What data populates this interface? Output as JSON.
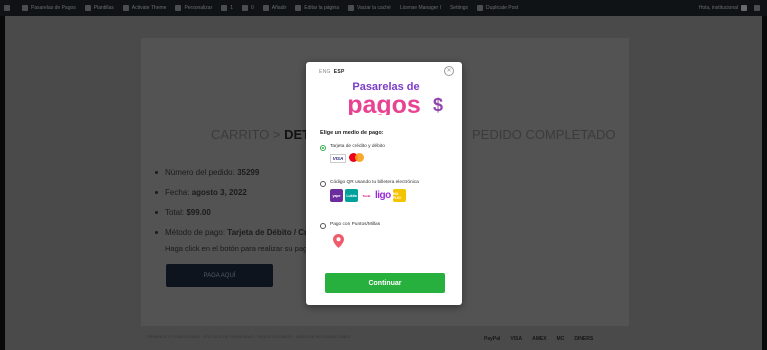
{
  "admin_bar": {
    "items": [
      "Pasarelas de Pagos",
      "Plantillas",
      "Activate Theme",
      "Personalizar",
      "1",
      "0",
      "Añadir",
      "Editar la página",
      "Vaciar la caché",
      "License Manager I",
      "Settings",
      "Duplicate Post"
    ],
    "greeting": "Hola, institucional"
  },
  "checkout": {
    "step1": "CARRITO",
    "sep": ">",
    "step2": "DETALLES DEL PAGO",
    "step3": "PEDIDO COMPLETADO",
    "order_number_label": "Número del pedido:",
    "order_number": "35299",
    "date_label": "Fecha:",
    "date": "agosto 3, 2022",
    "total_label": "Total:",
    "total": "$99.00",
    "method_label": "Método de pago:",
    "method": "Tarjeta de Débito / Crédito",
    "hint": "Haga click en el botón para realizar su pago",
    "pay_button": "PAGA AQUÍ"
  },
  "footer": {
    "links": "TÉRMINOS Y CONDICIONES · POLÍTICA DE PRIVACIDAD · PAGOS SEGUROS · LIBRO DE RECLAMACIONES",
    "payments": [
      "PayPal",
      "VISA",
      "AMEX",
      "MC",
      "DINERS"
    ]
  },
  "modal": {
    "lang_eng": "ENG",
    "lang_esp": "ESP",
    "close_symbol": "✕",
    "logo_line1": "Pasarelas de",
    "logo_line2": "pagos",
    "choose_label": "Elige un medio de pago:",
    "options": [
      {
        "label": "Tarjeta de crédito y débito",
        "selected": true
      },
      {
        "label": "Código QR usando tu billetera electrónica",
        "selected": false
      },
      {
        "label": "Pago con Puntos/Millas",
        "selected": false
      }
    ],
    "card_brands": [
      "VISA",
      "Mastercard"
    ],
    "qr_wallets": [
      "yape",
      "Lukita",
      "Tunki",
      "ligo",
      "MO PLIN"
    ],
    "continue_button": "Continuar"
  },
  "colors": {
    "accent_green": "#28b03e",
    "logo_purple": "#7d3cc8",
    "logo_orange": "#f39c12",
    "logo_pink": "#e84393",
    "dark_button": "#1b2637"
  }
}
